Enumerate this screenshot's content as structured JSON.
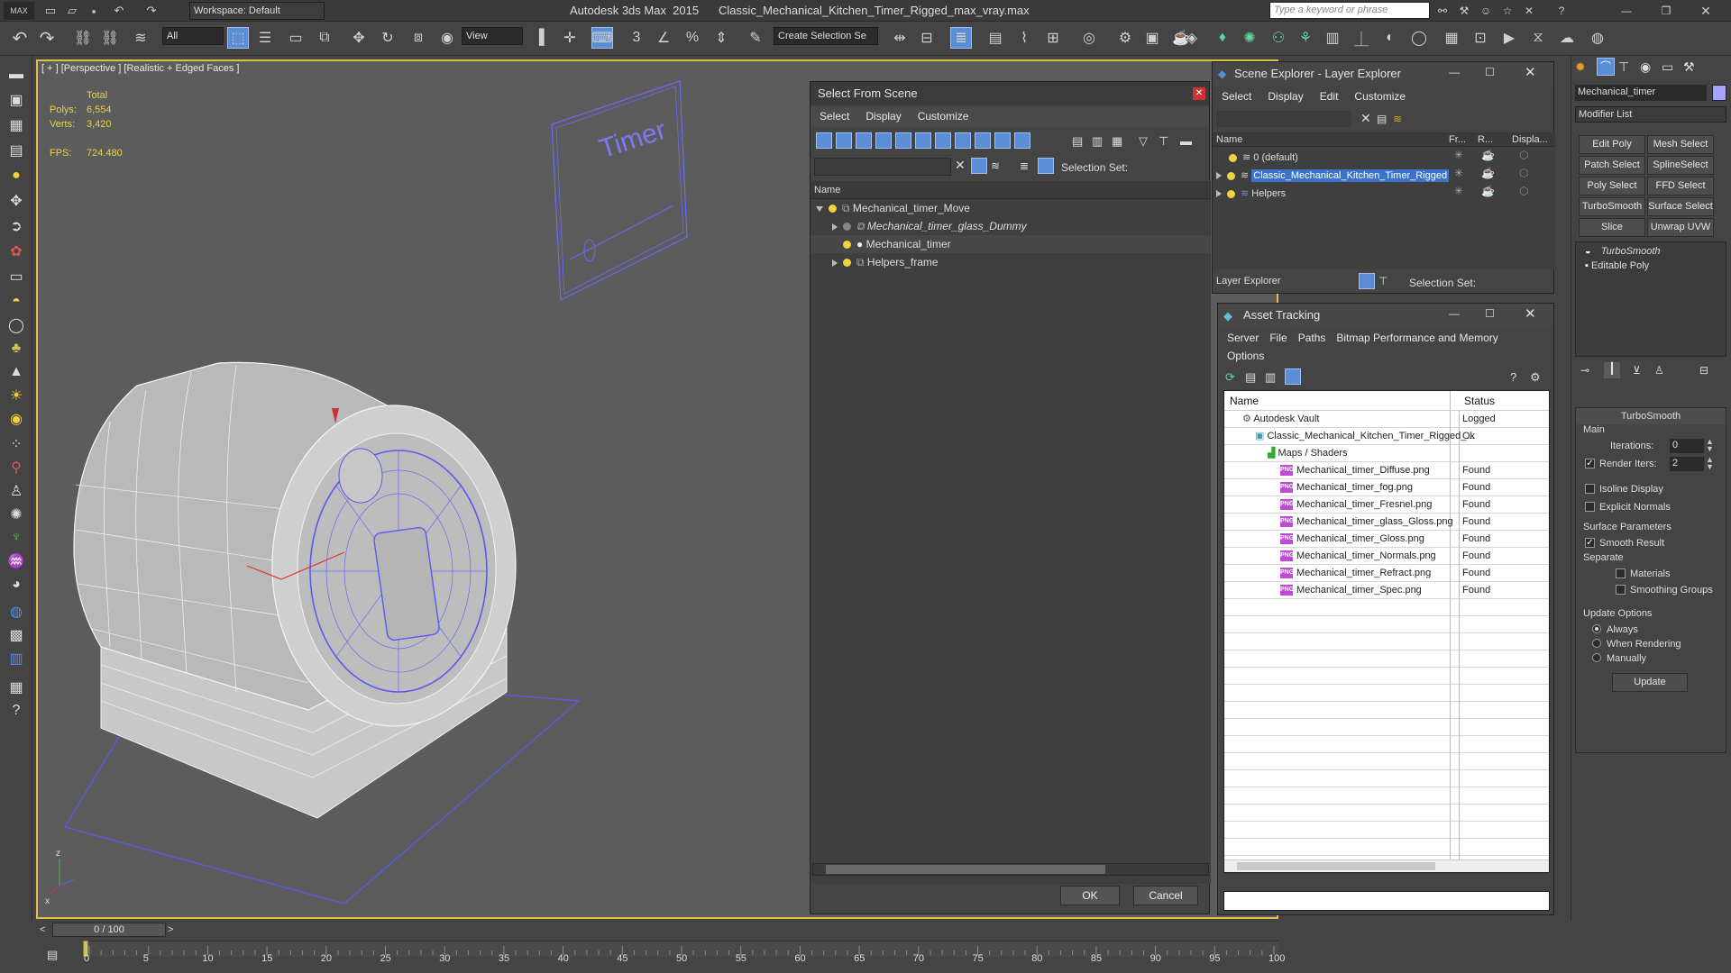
{
  "titlebar": {
    "workspace": "Workspace: Default",
    "app_title": "Autodesk 3ds Max  2015",
    "file_title": "Classic_Mechanical_Kitchen_Timer_Rigged_max_vray.max",
    "search_placeholder": "Type a keyword or phrase"
  },
  "toolbar": {
    "filter_value": "All",
    "ref_coord": "View",
    "selection_set": "Create Selection Se"
  },
  "viewport": {
    "label": "[ + ] [Perspective ] [Realistic + Edged Faces ]",
    "total_label": "Total",
    "polys_label": "Polys:",
    "polys_value": "6,554",
    "verts_label": "Verts:",
    "verts_value": "3,420",
    "fps_label": "FPS:",
    "fps_value": "724.480",
    "sign_text": "Timer",
    "axis_z": "z",
    "axis_x": "x"
  },
  "select_from_scene": {
    "title": "Select From Scene",
    "menus": [
      "Select",
      "Display",
      "Customize"
    ],
    "selection_set_label": "Selection Set:",
    "col_name": "Name",
    "items": [
      {
        "label": "Mechanical_timer_Move",
        "italic": false
      },
      {
        "label": "Mechanical_timer_glass_Dummy",
        "italic": true
      },
      {
        "label": "Mechanical_timer",
        "italic": false
      },
      {
        "label": "Helpers_frame",
        "italic": false
      }
    ],
    "ok": "OK",
    "cancel": "Cancel"
  },
  "scene_explorer": {
    "title": "Scene Explorer - Layer Explorer",
    "menus": [
      "Select",
      "Display",
      "Edit",
      "Customize"
    ],
    "cols": [
      "Name",
      "Fr...",
      "R...",
      "Displa..."
    ],
    "layers": [
      "0 (default)",
      "Classic_Mechanical_Kitchen_Timer_Rigged",
      "Helpers"
    ],
    "footer_dropdown": "Layer Explorer",
    "footer_selection_set": "Selection Set:"
  },
  "asset_tracking": {
    "title": "Asset Tracking",
    "menus": [
      "Server",
      "File",
      "Paths",
      "Bitmap Performance and Memory"
    ],
    "menus2": [
      "Options"
    ],
    "col_name": "Name",
    "col_status": "Status",
    "rows": [
      {
        "name": "Autodesk Vault",
        "status": "Logged",
        "level": 1
      },
      {
        "name": "Classic_Mechanical_Kitchen_Timer_Rigged_...",
        "status": "Ok",
        "level": 2
      },
      {
        "name": "Maps / Shaders",
        "status": "",
        "level": 3
      },
      {
        "name": "Mechanical_timer_Diffuse.png",
        "status": "Found",
        "level": 4
      },
      {
        "name": "Mechanical_timer_fog.png",
        "status": "Found",
        "level": 4
      },
      {
        "name": "Mechanical_timer_Fresnel.png",
        "status": "Found",
        "level": 4
      },
      {
        "name": "Mechanical_timer_glass_Gloss.png",
        "status": "Found",
        "level": 4
      },
      {
        "name": "Mechanical_timer_Gloss.png",
        "status": "Found",
        "level": 4
      },
      {
        "name": "Mechanical_timer_Normals.png",
        "status": "Found",
        "level": 4
      },
      {
        "name": "Mechanical_timer_Refract.png",
        "status": "Found",
        "level": 4
      },
      {
        "name": "Mechanical_timer_Spec.png",
        "status": "Found",
        "level": 4
      }
    ]
  },
  "command_panel": {
    "object_name": "Mechanical_timer",
    "modifier_list": "Modifier List",
    "buttons": [
      "Edit Poly",
      "Mesh Select",
      "Patch Select",
      "SplineSelect",
      "Poly Select",
      "FFD Select",
      "TurboSmooth",
      "Surface Select",
      "Slice",
      "Unwrap UVW"
    ],
    "stack": [
      "TurboSmooth",
      "Editable Poly"
    ],
    "rollout_title": "TurboSmooth",
    "main_label": "Main",
    "iterations_label": "Iterations:",
    "iterations_value": "0",
    "render_iters_label": "Render Iters:",
    "render_iters_value": "2",
    "isoline_label": "Isoline Display",
    "explicit_label": "Explicit Normals",
    "surface_params_label": "Surface Parameters",
    "smooth_result_label": "Smooth Result",
    "separate_label": "Separate",
    "materials_label": "Materials",
    "smoothing_groups_label": "Smoothing Groups",
    "update_options_label": "Update Options",
    "always_label": "Always",
    "when_rendering_label": "When Rendering",
    "manually_label": "Manually",
    "update_button": "Update"
  },
  "timeline": {
    "frame": "0 / 100",
    "ticks": [
      "0",
      "5",
      "10",
      "15",
      "20",
      "25",
      "30",
      "35",
      "40",
      "45",
      "50",
      "55",
      "60",
      "65",
      "70",
      "75",
      "80",
      "85",
      "90",
      "95",
      "100"
    ]
  },
  "colors": {
    "viewport_border": "#e0c04a",
    "selection_wire": "#5a5af0",
    "selected_row": "#3d72c9"
  }
}
